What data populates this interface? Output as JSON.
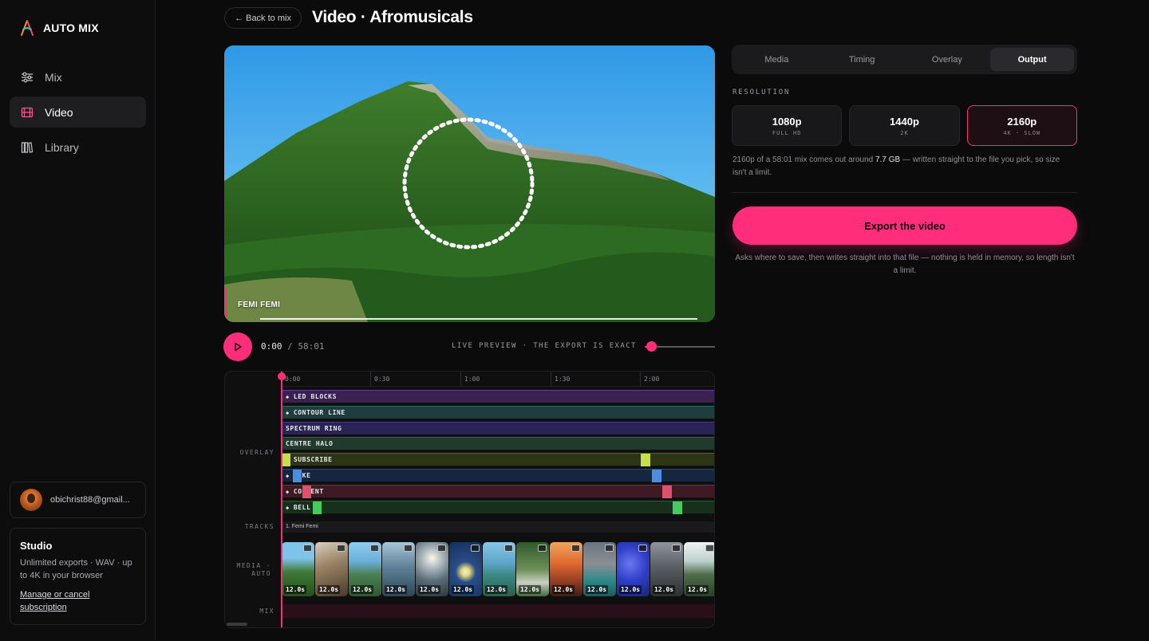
{
  "brand": {
    "name": "AUTO MIX"
  },
  "nav": {
    "items": [
      {
        "label": "Mix",
        "icon": "sliders-icon"
      },
      {
        "label": "Video",
        "icon": "film-icon",
        "active": true
      },
      {
        "label": "Library",
        "icon": "library-icon"
      }
    ]
  },
  "user": {
    "email": "obichrist88@gmail..."
  },
  "plan": {
    "title": "Studio",
    "description": "Unlimited exports · WAV · up to 4K in your browser",
    "link": "Manage or cancel subscription"
  },
  "header": {
    "back_label": "← Back to mix",
    "title": "Video · Afromusicals"
  },
  "preview": {
    "track_name": "FEMI FEMI"
  },
  "transport": {
    "current": "0:00",
    "separator": "/",
    "duration": "58:01",
    "live_label": "LIVE PREVIEW · THE EXPORT IS EXACT",
    "volume_fraction": 0.05
  },
  "timeline": {
    "ruler": [
      "0:00",
      "0:30",
      "1:00",
      "1:30",
      "2:00"
    ],
    "labels": {
      "overlay": "OVERLAY",
      "tracks": "TRACKS",
      "media": "MEDIA · AUTO",
      "mix": "MIX"
    },
    "overlays": [
      {
        "label": "LED BLOCKS",
        "diamond": true,
        "color": "#3b2150"
      },
      {
        "label": "CONTOUR LINE",
        "diamond": true,
        "color": "#1f3d3e"
      },
      {
        "label": "SPECTRUM RING",
        "diamond": false,
        "color": "#2a2456"
      },
      {
        "label": "CENTRE HALO",
        "diamond": false,
        "color": "#1f3b2b"
      },
      {
        "label": "SUBSCRIBE",
        "diamond": true,
        "color": "#2c3516"
      },
      {
        "label": "LIKE",
        "diamond": true,
        "color": "#172640"
      },
      {
        "label": "COMMENT",
        "diamond": true,
        "color": "#3d1a24"
      },
      {
        "label": "BELL",
        "diamond": true,
        "color": "#16301c"
      }
    ],
    "track_name": "1. Femi Femi",
    "clip_duration": "12.0s",
    "clip_count": 13
  },
  "panel": {
    "tabs": [
      "Media",
      "Timing",
      "Overlay",
      "Output"
    ],
    "active_tab": "Output",
    "resolution_label": "RESOLUTION",
    "resolutions": [
      {
        "main": "1080p",
        "sub": "FULL HD"
      },
      {
        "main": "1440p",
        "sub": "2K"
      },
      {
        "main": "2160p",
        "sub": "4K · SLOW",
        "selected": true
      }
    ],
    "note_before": "2160p of a 58:01 mix comes out around ",
    "note_size": "7.7 GB",
    "note_after": " — written straight to the file you pick, so size isn't a limit.",
    "export_label": "Export the video",
    "export_note": "Asks where to save, then writes straight into that file — nothing is held in memory, so length isn't a limit."
  },
  "colors": {
    "accent": "#ff2d7a"
  }
}
